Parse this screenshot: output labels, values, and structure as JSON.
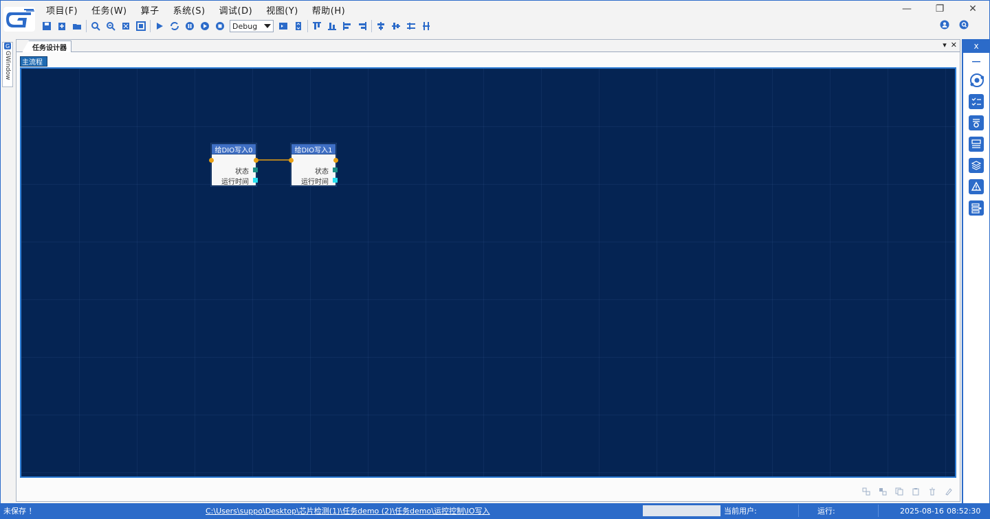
{
  "menu": [
    "项目(F)",
    "任务(W)",
    "算子",
    "系统(S)",
    "调试(D)",
    "视图(Y)",
    "帮助(H)"
  ],
  "toolbar": {
    "mode_value": "Debug",
    "buttons": [
      "save",
      "new",
      "open",
      "zoom-in",
      "zoom-out",
      "fit",
      "fullscreen",
      "run",
      "loop",
      "pause",
      "step",
      "stop",
      "expand",
      "collapse",
      "align-top",
      "align-bottom",
      "align-left",
      "align-right",
      "align-center-h",
      "align-center-v",
      "distribute-h",
      "distribute-v"
    ]
  },
  "window": {
    "minimize": "—",
    "restore": "❐",
    "close": "✕"
  },
  "left_pane": {
    "tab_label": "GWindow"
  },
  "document": {
    "tab_label": "任务设计器",
    "subtab_label": "主流程",
    "nodes": [
      {
        "title": "给DIO写入0",
        "rows": [
          "状态",
          "运行时间"
        ]
      },
      {
        "title": "给DIO写入1",
        "rows": [
          "状态",
          "运行时间"
        ]
      }
    ]
  },
  "right_pane": {
    "close_label": "x"
  },
  "status": {
    "unsaved": "未保存 ！",
    "path": "C:\\Users\\suppo\\Desktop\\芯片检测(1)\\任务demo (2)\\任务demo\\运控控制\\IO写入",
    "current_user_label": "当前用户:",
    "run_label": "运行:",
    "date": "2025-08-16",
    "time": "08:52:30"
  },
  "colors": {
    "accent": "#2c6bc9",
    "canvas_bg": "#052453",
    "node_header": "#3f6fc4",
    "port_orange": "#e8a013",
    "port_teal": "#1e8f87",
    "port_cyan": "#28e0f0"
  }
}
